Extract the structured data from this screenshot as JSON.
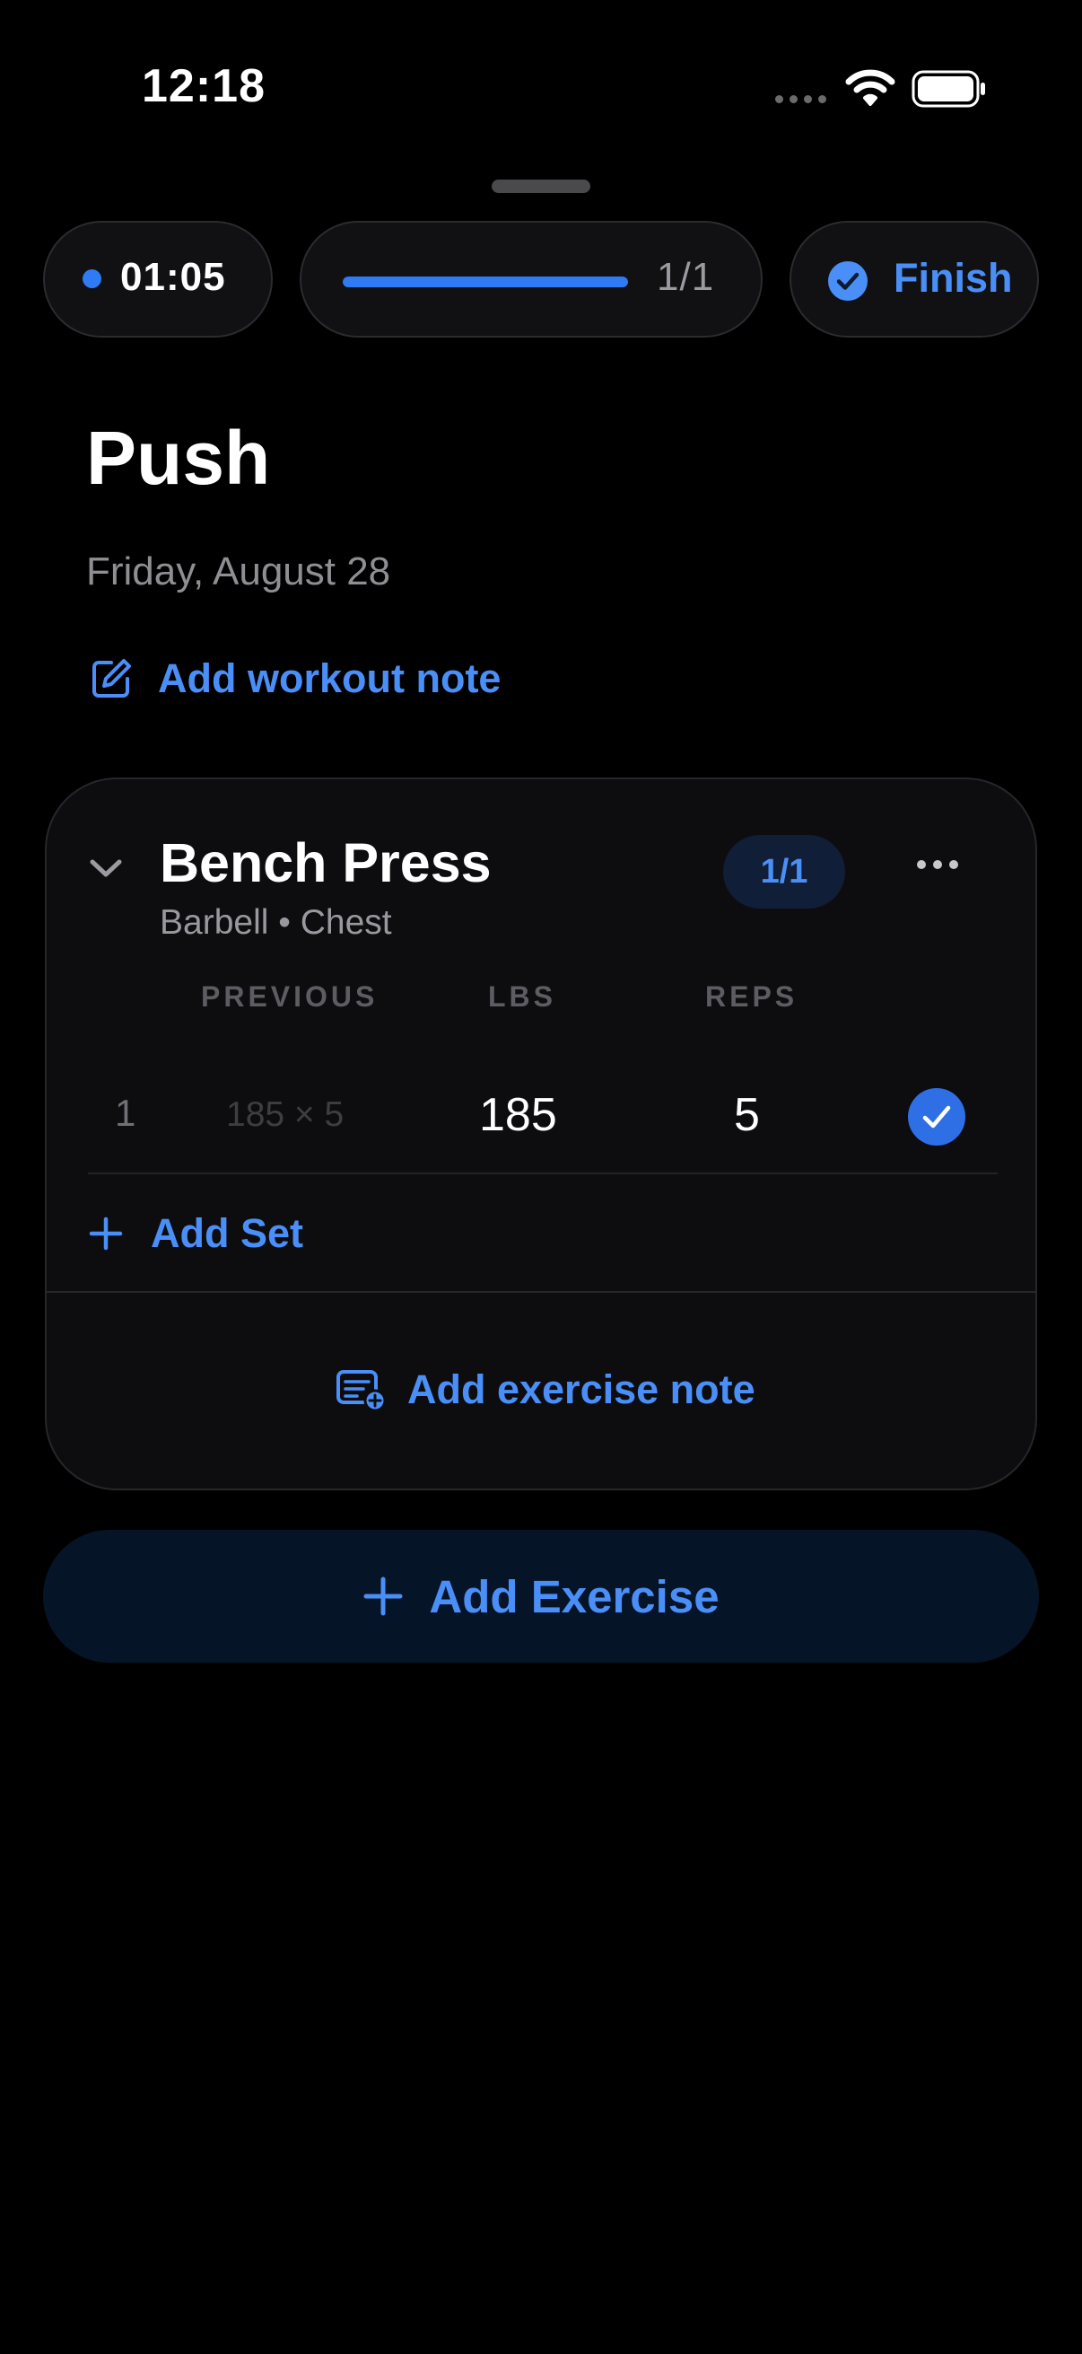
{
  "status_bar": {
    "time": "12:18"
  },
  "workout_bar": {
    "timer": "01:05",
    "progress_text": "1/1",
    "progress_fraction": 1.0,
    "finish_label": "Finish"
  },
  "workout": {
    "title": "Push",
    "date": "Friday, August 28",
    "add_note_label": "Add workout note"
  },
  "exercise": {
    "name": "Bench Press",
    "subtitle": "Barbell • Chest",
    "badge": "1/1",
    "columns": {
      "previous": "PREVIOUS",
      "lbs": "LBS",
      "reps": "REPS"
    },
    "sets": [
      {
        "number": "1",
        "previous": "185 × 5",
        "lbs": "185",
        "reps": "5",
        "completed": true
      }
    ],
    "add_set_label": "Add Set",
    "add_note_label": "Add exercise note"
  },
  "add_exercise_label": "Add Exercise",
  "colors": {
    "accent": "#4a8ff8",
    "accent_fill": "#2f6fe6",
    "background": "#000000",
    "card": "#0d0d10"
  },
  "icons": [
    "wifi-icon",
    "battery-icon",
    "checkmark-circle-icon",
    "edit-note-icon",
    "chevron-down-icon",
    "more-icon",
    "checkmark-icon",
    "plus-icon",
    "note-add-icon"
  ]
}
